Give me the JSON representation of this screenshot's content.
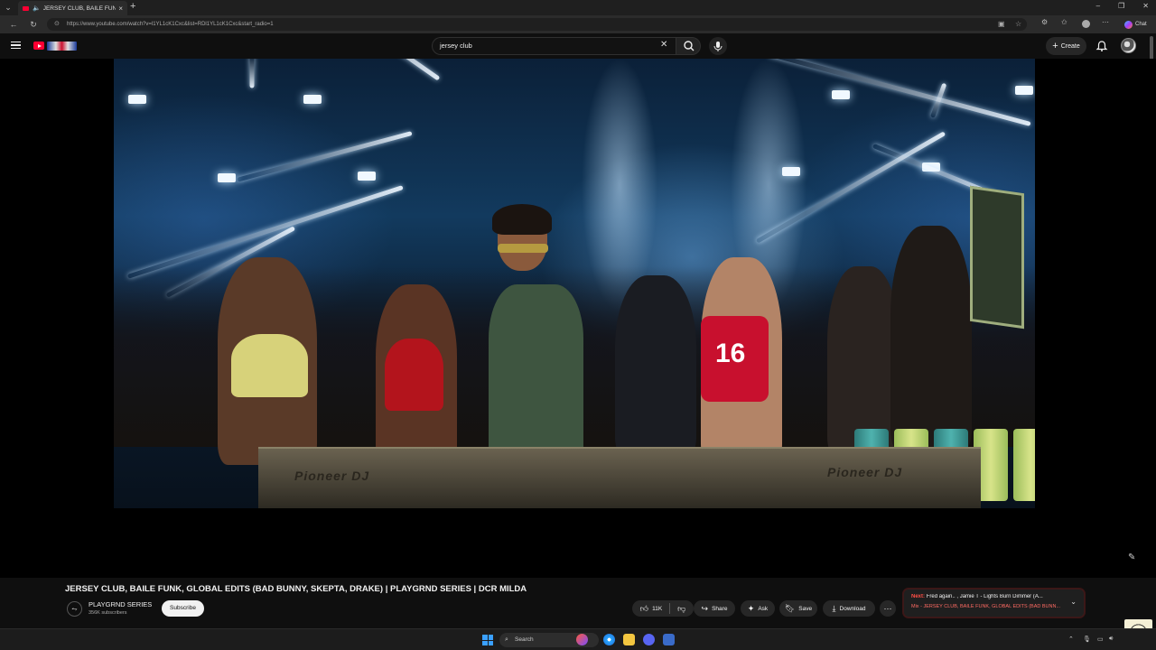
{
  "browser": {
    "tab_title": "JERSEY CLUB, BAILE FUNK, G",
    "url": "https://www.youtube.com/watch?v=l1YL1cK1Cxc&list=RDl1YL1cK1Cxc&start_radio=1",
    "chat_label": "Chat"
  },
  "youtube": {
    "search_value": "jersey club",
    "create_label": "Create"
  },
  "video": {
    "title": "JERSEY CLUB, BAILE FUNK, GLOBAL EDITS (BAD BUNNY, SKEPTA, DRAKE) | PLAYGRND SERIES | DCR MILDA",
    "channel_name": "PLAYGRND SERIES",
    "subscribers": "356K subscribers",
    "subscribe_label": "Subscribe",
    "likes": "11K",
    "share_label": "Share",
    "ask_label": "Ask",
    "save_label": "Save",
    "download_label": "Download",
    "shirt_number": "16",
    "deck_brand": "Pioneer DJ"
  },
  "next_up": {
    "prefix": "Next:",
    "track": "Fred again.. , Jamie T - Lights Burn Dimmer (A...",
    "mix": "Mix - JERSEY CLUB, BAILE FUNK, GLOBAL EDITS (BAD BUNN..."
  },
  "taskbar": {
    "search_placeholder": "Search"
  },
  "colors": {
    "accent": "#ff0033",
    "background": "#0f0f0f"
  }
}
